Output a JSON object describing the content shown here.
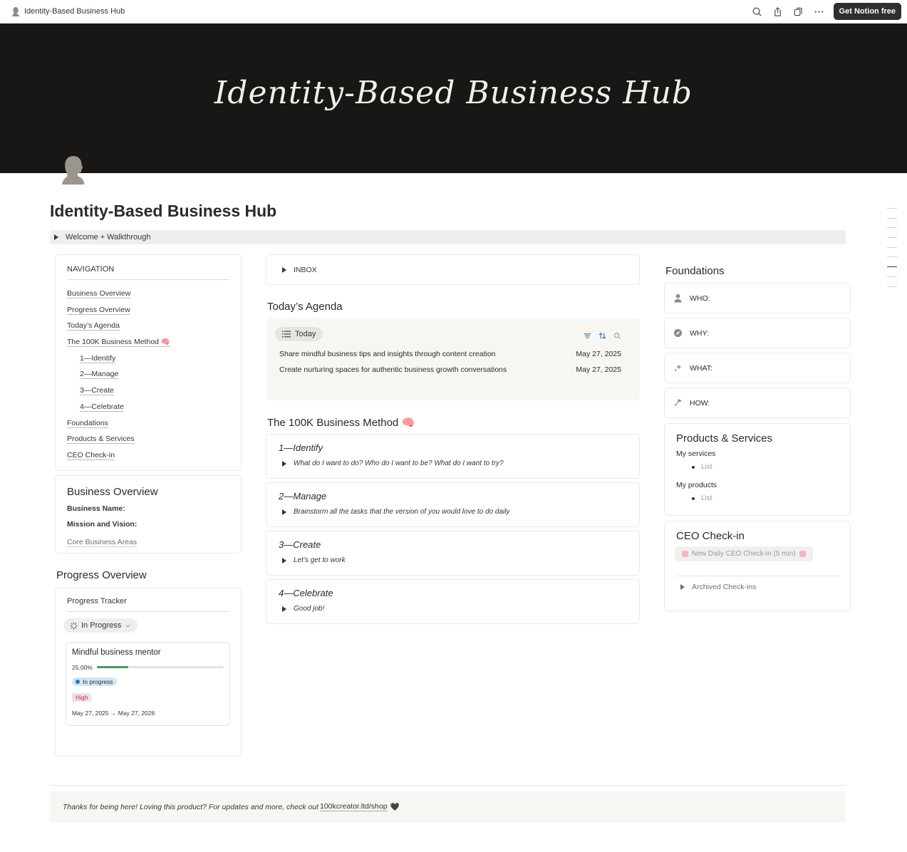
{
  "topbar": {
    "page_name": "Identity-Based Business Hub",
    "cta_label": "Get Notion free",
    "icons": [
      "search-icon",
      "share-icon",
      "duplicate-icon",
      "more-icon"
    ]
  },
  "cover": {
    "text": "Identity-Based Business Hub"
  },
  "page": {
    "title": "Identity-Based Business Hub",
    "welcome_toggle": "Welcome + Walkthrough"
  },
  "navigation": {
    "title": "NAVIGATION",
    "items": [
      {
        "label": "Business Overview",
        "sub": false
      },
      {
        "label": "Progress Overview",
        "sub": false
      },
      {
        "label": "Today’s Agenda",
        "sub": false
      },
      {
        "label": "The 100K Business Method 🧠",
        "sub": false
      },
      {
        "label": "1—Identify",
        "sub": true
      },
      {
        "label": "2—Manage",
        "sub": true
      },
      {
        "label": "3—Create",
        "sub": true
      },
      {
        "label": "4—Celebrate",
        "sub": true
      },
      {
        "label": "Foundations",
        "sub": false
      },
      {
        "label": "Products & Services",
        "sub": false
      },
      {
        "label": "CEO Check-in",
        "sub": false
      }
    ]
  },
  "business_overview": {
    "title": "Business Overview",
    "business_name": "Business Name:",
    "mission": "Mission and Vision:",
    "core_link": "Core Business Areas"
  },
  "progress_overview": {
    "title": "Progress Overview",
    "tracker_title": "Progress Tracker",
    "filter_label": "In Progress",
    "card": {
      "name": "Mindful business mentor",
      "progress_text": "25.00%",
      "progress": 0.25,
      "status": "In progress",
      "priority": "High",
      "dates": "May 27, 2025 → May 27, 2026"
    }
  },
  "inbox": {
    "label": "INBOX"
  },
  "agenda": {
    "title": "Today’s Agenda",
    "view_label": "Today",
    "rows": [
      {
        "task": "Share mindful business tips and insights through content creation",
        "date": "May 27, 2025"
      },
      {
        "task": "Create nurturing spaces for authentic business growth conversations",
        "date": "May 27, 2025"
      }
    ]
  },
  "method": {
    "title": "The 100K Business Method 🧠",
    "steps": [
      {
        "title": "1—Identify",
        "desc": "What do I want to do? Who do I want to be? What do I want to try?"
      },
      {
        "title": "2—Manage",
        "desc": "Brainstorm all the tasks that the version of you would love to do daily"
      },
      {
        "title": "3—Create",
        "desc": "Let’s get to work"
      },
      {
        "title": "4—Celebrate",
        "desc": "Good job!"
      }
    ]
  },
  "foundations": {
    "title": "Foundations",
    "items": [
      {
        "label": "WHO:",
        "icon": "person-icon"
      },
      {
        "label": "WHY:",
        "icon": "compass-icon"
      },
      {
        "label": "WHAT:",
        "icon": "sparkle-icon"
      },
      {
        "label": "HOW:",
        "icon": "hammer-icon"
      }
    ]
  },
  "products": {
    "title": "Products & Services",
    "services_label": "My services",
    "services_item": "List",
    "products_label": "My products",
    "products_item": "List"
  },
  "ceo": {
    "title": "CEO Check-in",
    "button_label": "New Daily CEO Check-in (5 min)",
    "archived_label": "Archived Check-ins"
  },
  "footer": {
    "text": "Thanks for being here! Loving this product? For updates and more, check out",
    "link": "100kcreator.ltd/shop",
    "heart": "🖤"
  },
  "colors": {
    "cover_bg": "#191716",
    "progress_fill": "#4f9167",
    "status_blue": "#d3e5ef",
    "priority_pink": "#f5dde9",
    "cta_bg": "#2f2f2f"
  }
}
